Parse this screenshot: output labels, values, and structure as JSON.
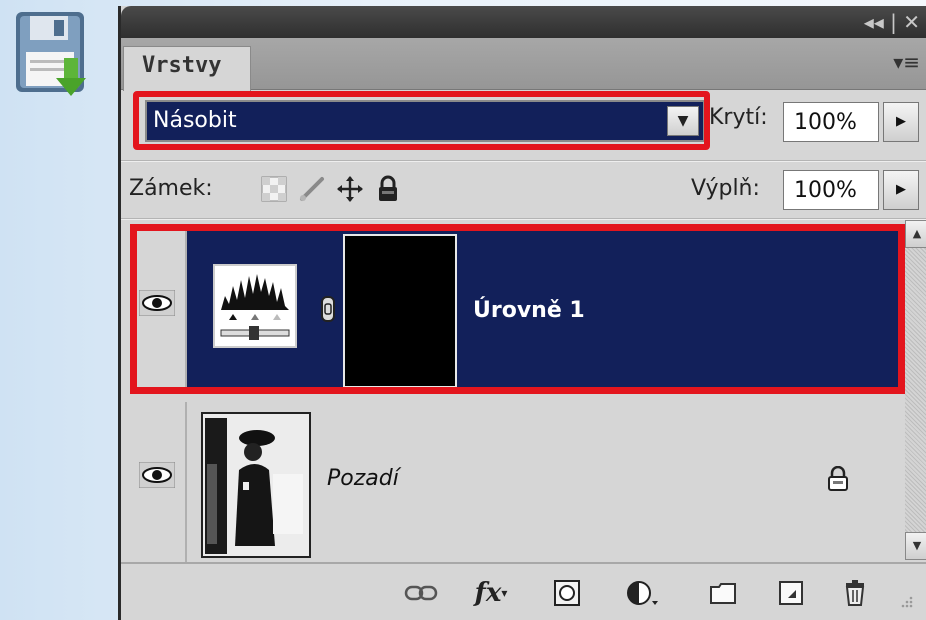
{
  "panel": {
    "tab_label": "Vrstvy",
    "blend_mode": "Násobit",
    "opacity_label": "Krytí:",
    "opacity_value": "100%",
    "lock_label": "Zámek:",
    "fill_label": "Výplň:",
    "fill_value": "100%"
  },
  "layers": [
    {
      "name": "Úrovně 1",
      "visible": true,
      "selected": true
    },
    {
      "name": "Pozadí",
      "visible": true,
      "selected": false,
      "locked": true
    }
  ],
  "colors": {
    "selection": "#12205a",
    "highlight": "#e3151d"
  }
}
